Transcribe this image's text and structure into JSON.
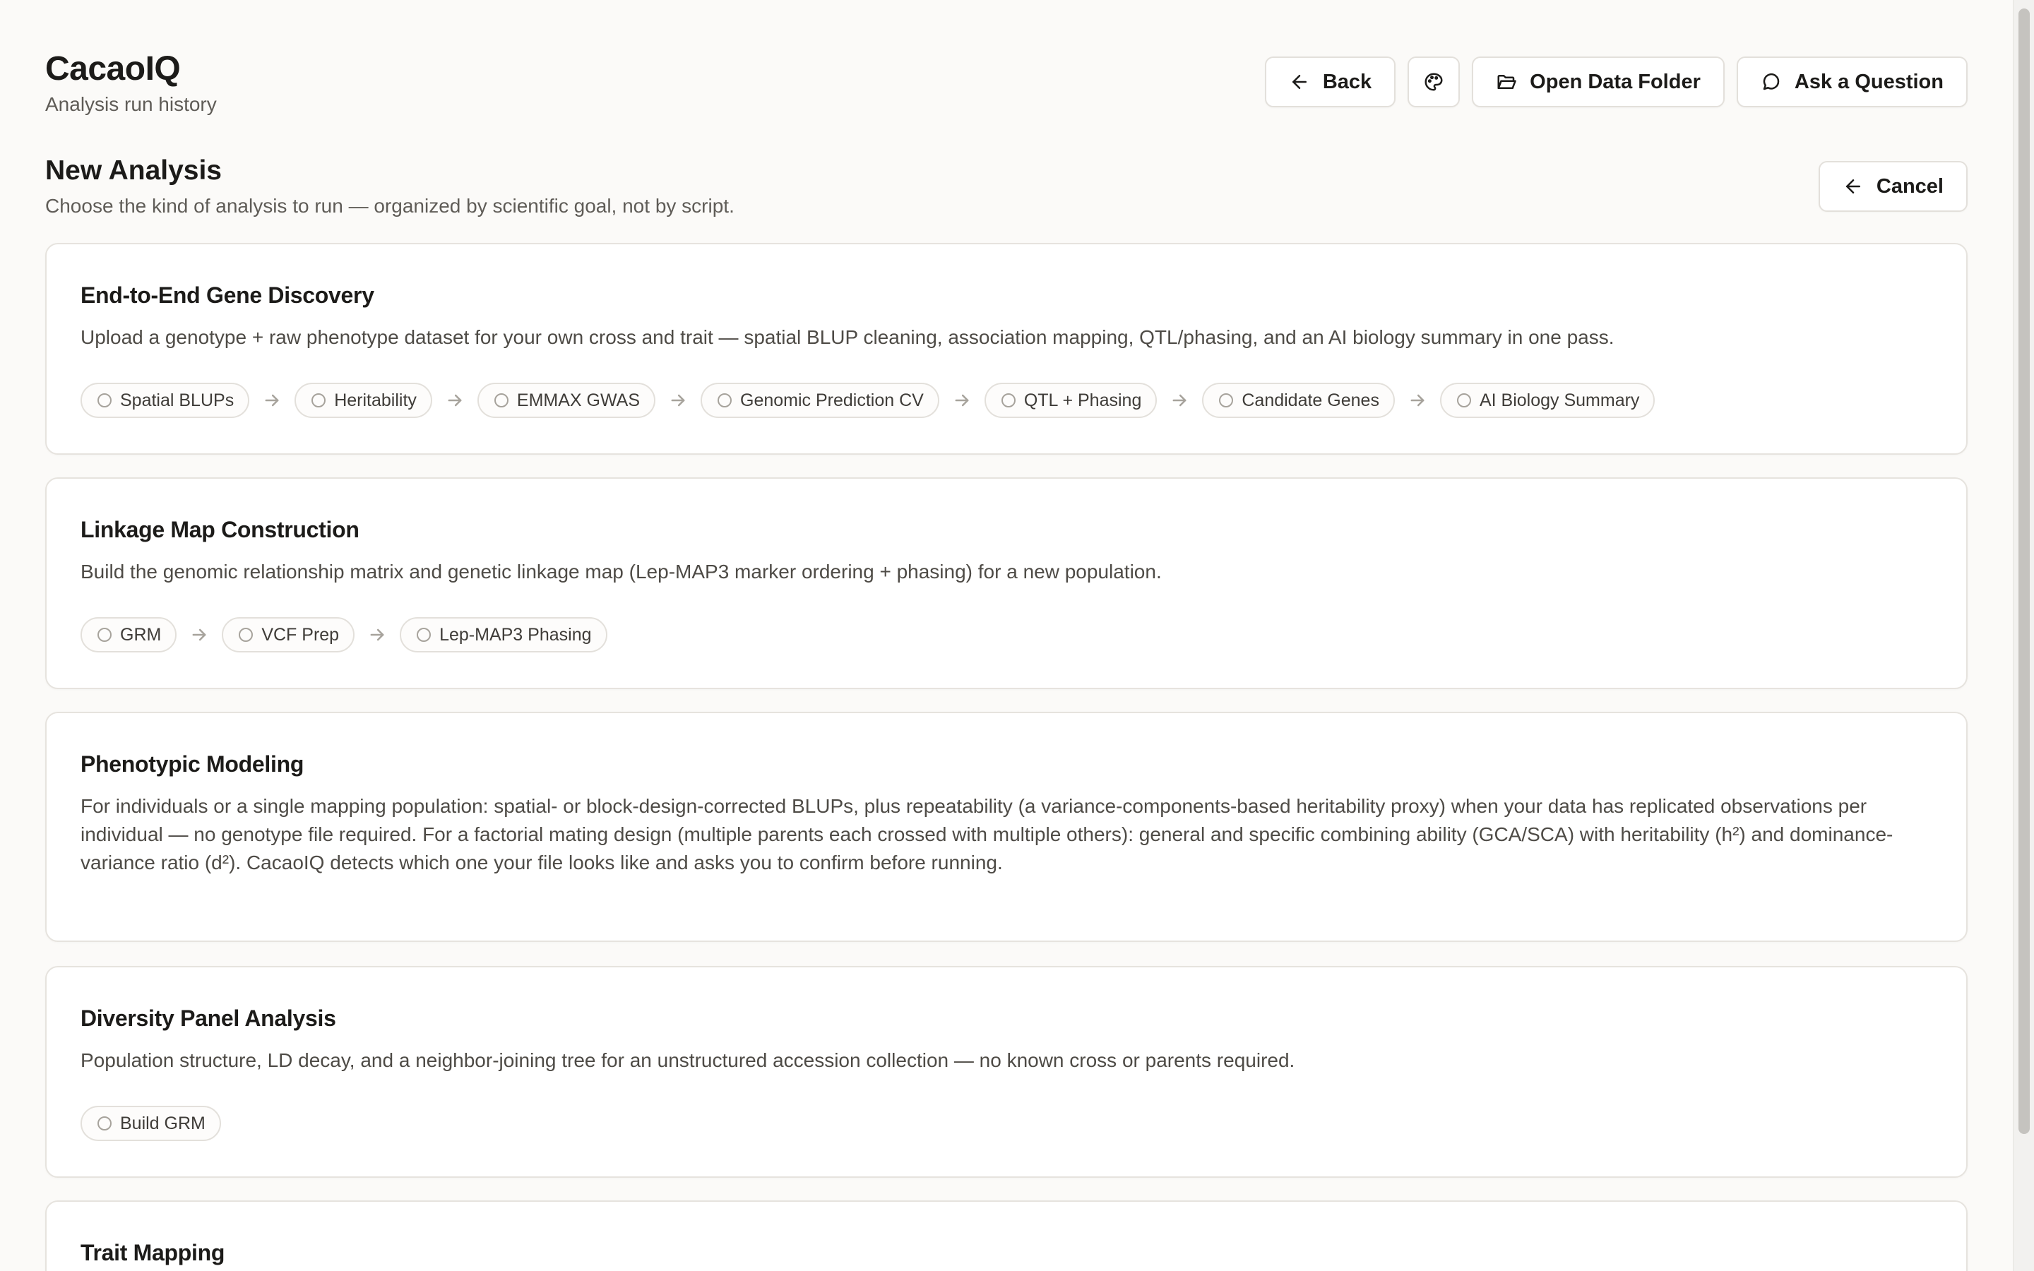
{
  "app": {
    "title": "CacaoIQ",
    "subtitle": "Analysis run history"
  },
  "header_buttons": {
    "back": "Back",
    "theme_icon": "palette-icon",
    "open_folder": "Open Data Folder",
    "ask": "Ask a Question"
  },
  "section": {
    "title": "New Analysis",
    "subtitle": "Choose the kind of analysis to run — organized by scientific goal, not by script.",
    "cancel": "Cancel"
  },
  "cards": [
    {
      "title": "End-to-End Gene Discovery",
      "description": "Upload a genotype + raw phenotype dataset for your own cross and trait — spatial BLUP cleaning, association mapping, QTL/phasing, and an AI biology summary in one pass.",
      "steps": [
        "Spatial BLUPs",
        "Heritability",
        "EMMAX GWAS",
        "Genomic Prediction CV",
        "QTL + Phasing",
        "Candidate Genes",
        "AI Biology Summary"
      ]
    },
    {
      "title": "Linkage Map Construction",
      "description": "Build the genomic relationship matrix and genetic linkage map (Lep-MAP3 marker ordering + phasing) for a new population.",
      "steps": [
        "GRM",
        "VCF Prep",
        "Lep-MAP3 Phasing"
      ]
    },
    {
      "title": "Phenotypic Modeling",
      "description": "For individuals or a single mapping population: spatial- or block-design-corrected BLUPs, plus repeatability (a variance-components-based heritability proxy) when your data has replicated observations per individual — no genotype file required. For a factorial mating design (multiple parents each crossed with multiple others): general and specific combining ability (GCA/SCA) with heritability (h²) and dominance-variance ratio (d²). CacaoIQ detects which one your file looks like and asks you to confirm before running.",
      "steps": []
    },
    {
      "title": "Diversity Panel Analysis",
      "description": "Population structure, LD decay, and a neighbor-joining tree for an unstructured accession collection — no known cross or parents required.",
      "steps": [
        "Build GRM"
      ]
    },
    {
      "title": "Trait Mapping",
      "description": "",
      "steps": []
    }
  ]
}
